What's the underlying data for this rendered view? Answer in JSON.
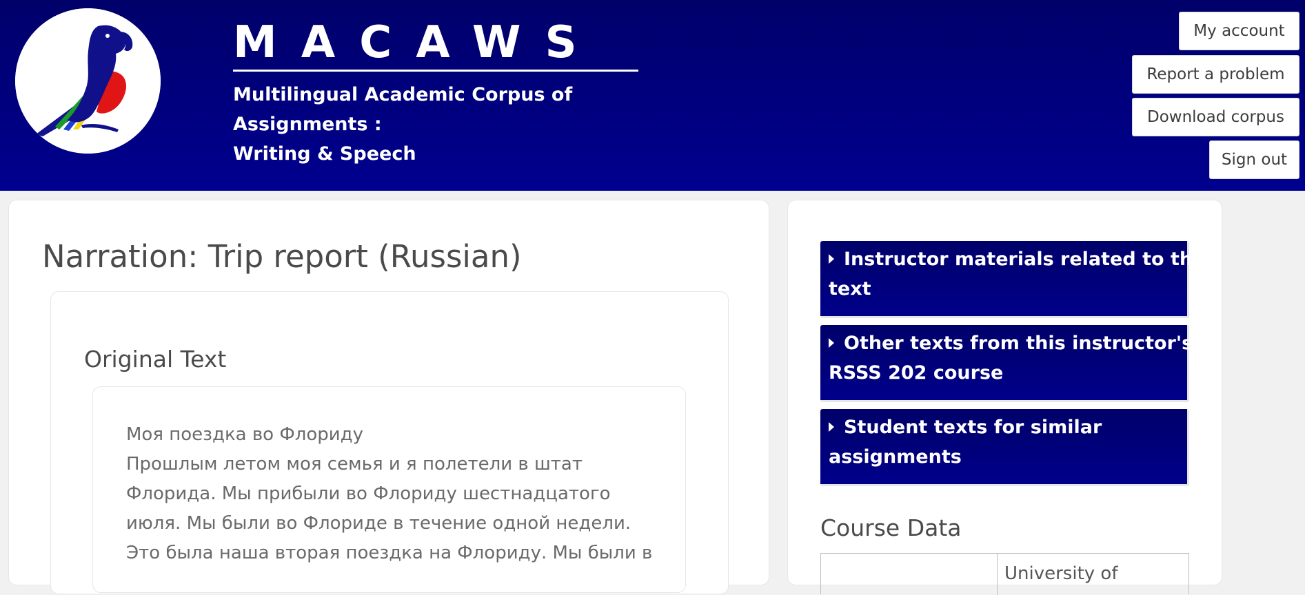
{
  "header": {
    "site_title": "MACAWS",
    "subtitle_lines": [
      "Multilingual Academic Corpus of",
      "Assignments :",
      "Writing & Speech"
    ],
    "buttons": {
      "my_account": "My account",
      "report_problem": "Report a problem",
      "download_corpus": "Download corpus",
      "sign_out": "Sign out"
    },
    "logo_icon": "macaw-parrot-logo"
  },
  "main": {
    "page_title": "Narration: Trip report (Russian)",
    "section_title": "Original Text",
    "original_text_lines": [
      "Моя поездка во Флориду",
      "Прошлым летом моя семья и я полетели в штат",
      "Флорида. Мы прибыли во Флориду шестнадцатого",
      "июля. Мы были во Флориде в течение одной недели.",
      "Это была наша вторая поездка на Флориду. Мы были в"
    ]
  },
  "sidebar": {
    "accordions": [
      {
        "lines": [
          "Instructor materials related to this",
          "text"
        ]
      },
      {
        "lines": [
          "Other texts from this instructor's",
          "RSSS 202 course"
        ]
      },
      {
        "lines": [
          "Student texts for similar",
          "assignments"
        ]
      }
    ],
    "course_data_title": "Course Data",
    "course_table_partial_value": "University of"
  },
  "colors": {
    "header_bg": "#000080",
    "accordion_bg": "#000080",
    "text_dark": "#4a4a4a"
  }
}
